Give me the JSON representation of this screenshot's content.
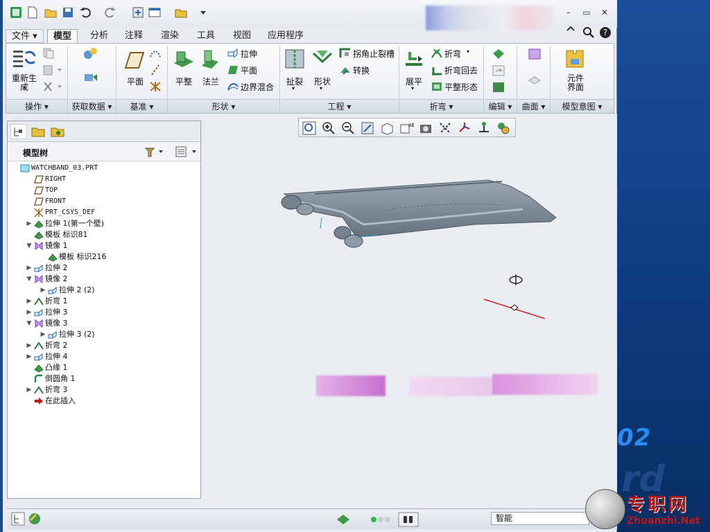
{
  "quick_access": {
    "icons": [
      "app-icon",
      "new-icon",
      "open-icon",
      "save-icon",
      "undo-icon",
      "redo-icon",
      "regenerate-icon",
      "window-icon",
      "folder-icon",
      "more-icon"
    ]
  },
  "window_buttons": {
    "minimize": "–",
    "restore": "▭",
    "close": "✕"
  },
  "tabs": [
    {
      "label": "文件 ▾"
    },
    {
      "label": "模型",
      "active": true
    },
    {
      "label": "分析"
    },
    {
      "label": "注释"
    },
    {
      "label": "渲染"
    },
    {
      "label": "工具"
    },
    {
      "label": "视图"
    },
    {
      "label": "应用程序"
    }
  ],
  "ribbon": {
    "regen_label": "重新生\n成",
    "regen_caret": "▾",
    "plane_label": "平面",
    "flat_label": "平整",
    "flange_label": "法兰",
    "extrude_label": "拉伸",
    "plane2_label": "平面",
    "boundary_label": "边界混合",
    "rip_label": "扯裂",
    "form_label": "形状",
    "corner_relief_label": "拐角止裂槽",
    "convert_label": "转换",
    "unbend_label": "展平",
    "bend_label": "折弯",
    "bend_back_label": "折弯回去",
    "flat_pattern_label": "平整形态",
    "component_label": "元件\n界面",
    "groups": [
      "操作 ▾",
      "获取数据 ▾",
      "基准 ▾",
      "形状 ▾",
      "工程 ▾",
      "折弯 ▾",
      "编辑 ▾",
      "曲面 ▾",
      "模型意图 ▾"
    ]
  },
  "tree": {
    "title": "模型树",
    "items": [
      {
        "text": "WATCHBAND_03.PRT",
        "indent": 0,
        "expand": "",
        "icon": "part-icon",
        "mono": true
      },
      {
        "text": "RIGHT",
        "indent": 1,
        "expand": "",
        "icon": "datum-plane-icon",
        "mono": true
      },
      {
        "text": "TOP",
        "indent": 1,
        "expand": "",
        "icon": "datum-plane-icon",
        "mono": true
      },
      {
        "text": "FRONT",
        "indent": 1,
        "expand": "",
        "icon": "datum-plane-icon",
        "mono": true
      },
      {
        "text": "PRT_CSYS_DEF",
        "indent": 1,
        "expand": "",
        "icon": "csys-icon",
        "mono": true
      },
      {
        "text": "拉伸 1(第一个壁)",
        "indent": 1,
        "expand": "▶",
        "icon": "wall-icon"
      },
      {
        "text": "模板 标识81",
        "indent": 1,
        "expand": "",
        "icon": "form-icon"
      },
      {
        "text": "镜像 1",
        "indent": 1,
        "expand": "▼",
        "icon": "mirror-icon"
      },
      {
        "text": "模板 标识216",
        "indent": 2,
        "expand": "",
        "icon": "form-icon"
      },
      {
        "text": "拉伸 2",
        "indent": 1,
        "expand": "▶",
        "icon": "extrude-icon"
      },
      {
        "text": "镜像 2",
        "indent": 1,
        "expand": "▼",
        "icon": "mirror-icon"
      },
      {
        "text": "拉伸 2 (2)",
        "indent": 2,
        "expand": "▶",
        "icon": "extrude-icon"
      },
      {
        "text": "折弯 1",
        "indent": 1,
        "expand": "▶",
        "icon": "bend-icon"
      },
      {
        "text": "拉伸 3",
        "indent": 1,
        "expand": "▶",
        "icon": "extrude-icon"
      },
      {
        "text": "镜像 3",
        "indent": 1,
        "expand": "▼",
        "icon": "mirror-icon"
      },
      {
        "text": "拉伸 3 (2)",
        "indent": 2,
        "expand": "▶",
        "icon": "extrude-icon"
      },
      {
        "text": "折弯 2",
        "indent": 1,
        "expand": "▶",
        "icon": "bend-icon"
      },
      {
        "text": "拉伸 4",
        "indent": 1,
        "expand": "▶",
        "icon": "extrude-icon"
      },
      {
        "text": "凸缘 1",
        "indent": 1,
        "expand": "",
        "icon": "flange-icon"
      },
      {
        "text": "倒圆角 1",
        "indent": 1,
        "expand": "",
        "icon": "round-icon"
      },
      {
        "text": "折弯 3",
        "indent": 1,
        "expand": "▶",
        "icon": "bend-icon"
      },
      {
        "text": "在此插入",
        "indent": 1,
        "expand": "",
        "icon": "insert-arrow-icon"
      }
    ]
  },
  "status": {
    "smart": "智能"
  },
  "watermark": {
    "cn": "专职网",
    "url": "Zhuanzhi.Net"
  },
  "desktop": {
    "number": "02"
  },
  "colors": {
    "accent": "#2a64b0",
    "part": "#7d8b98",
    "axis_line": "#d22020"
  }
}
